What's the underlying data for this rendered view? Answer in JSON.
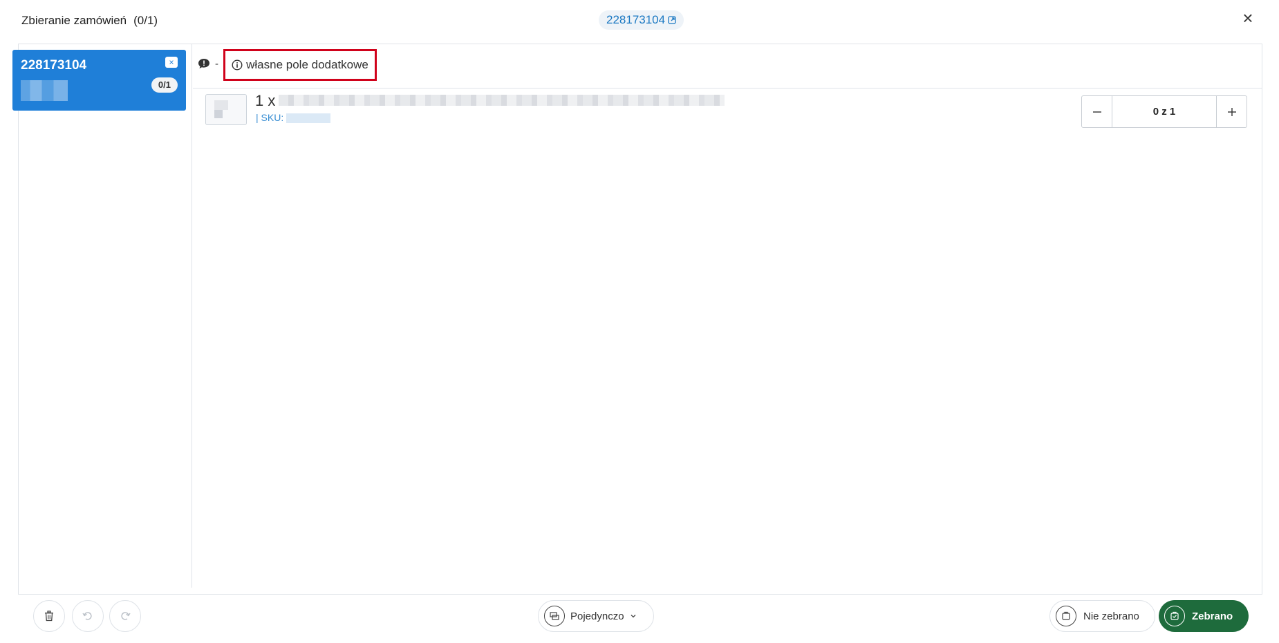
{
  "header": {
    "title": "Zbieranie zamówień",
    "count": "(0/1)",
    "order_link": "228173104"
  },
  "sidebar": {
    "orders": [
      {
        "number": "228173104",
        "progress": "0/1"
      }
    ]
  },
  "info_bar": {
    "separator": "-",
    "extra_field": "własne pole dodatkowe"
  },
  "items": [
    {
      "qty_prefix": "1 x",
      "sku_label": "| SKU:",
      "stepper_value": "0 z 1"
    }
  ],
  "footer": {
    "mode_label": "Pojedynczo",
    "not_collected_label": "Nie zebrano",
    "collected_label": "Zebrano"
  },
  "colors": {
    "accent_blue": "#1f7fd8",
    "link_blue": "#1a78c2",
    "highlight_red": "#d0021b",
    "success_green": "#1e6b3c"
  },
  "icons": [
    "external-link-icon",
    "close-icon",
    "comment-icon",
    "info-icon",
    "trash-icon",
    "undo-icon",
    "redo-icon",
    "mode-icon",
    "chevron-down-icon",
    "box-icon"
  ]
}
